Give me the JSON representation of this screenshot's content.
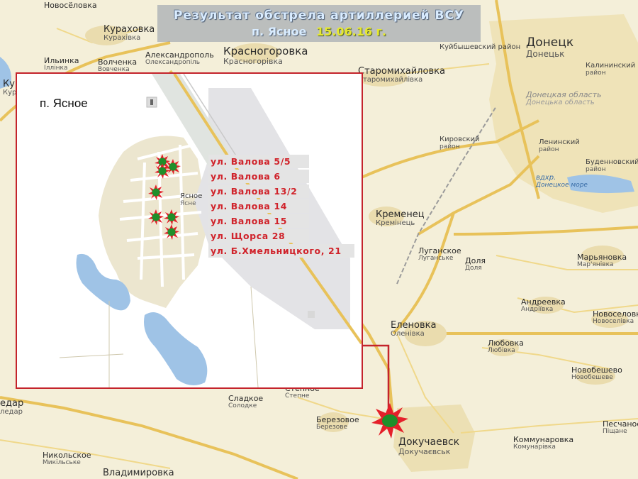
{
  "title": {
    "line1": "Результат обстрела артиллерией ВСУ",
    "place": "п. Ясное",
    "date": "15.06.16 г."
  },
  "colors": {
    "accent_red": "#d0232b",
    "explosion_red": "#e5202a",
    "explosion_green": "#1f8f2a",
    "date_yellow": "#e6e830",
    "banner_bg": "#8c96a5"
  },
  "inset": {
    "title": "п. Ясное",
    "village_label_ru": "Ясное",
    "village_label_ua": "Ясне",
    "addresses": [
      "ул. Валова 5/5",
      "ул. Валова 6",
      "ул. Валова 13/2",
      "ул. Валова 14",
      "ул. Валова 15",
      "ул. Щорса 28",
      "ул. Б.Хмельницкого, 21"
    ]
  },
  "icons": {
    "impact": "explosion-icon",
    "monument": "monument-icon"
  },
  "map_labels": {
    "novoselovka": {
      "ru": "Новосёловка"
    },
    "kurakhovka": {
      "ru": "Кураховка",
      "ua": "Курахівка"
    },
    "ilyinka": {
      "ru": "Ильинка",
      "ua": "Іллінка"
    },
    "kura": {
      "ru": "Кура",
      "ua": "Кур"
    },
    "volchenka": {
      "ru": "Волченка",
      "ua": "Вовченка"
    },
    "aleksandropol": {
      "ru": "Александрополь",
      "ua": "Олександропіль"
    },
    "krasnogorovka": {
      "ru": "Красногоровка",
      "ua": "Красногорівка"
    },
    "staromikhaylovka": {
      "ru": "Старомихайловка",
      "ua": "Старомихайлівка"
    },
    "donetsk": {
      "ru": "Донецк",
      "ua": "Донецьк"
    },
    "kuybyshevsky": {
      "ru": "Куйбышевский район"
    },
    "kalininsky": {
      "ru": "Калининский",
      "ua": "район"
    },
    "oblast": {
      "ru": "Донецкая область",
      "ua": "Донецька область"
    },
    "kirovsky": {
      "ru": "Кировский",
      "ua": "район"
    },
    "leninsky": {
      "ru": "Ленинский",
      "ua": "район"
    },
    "budennovsky": {
      "ru": "Буденновский",
      "ua": "район"
    },
    "reservoir": {
      "ru": "вдхр.",
      "ua": "Донецкое море"
    },
    "kremenets": {
      "ru": "Кременец",
      "ua": "Кремінець"
    },
    "luganskoe": {
      "ru": "Луганское",
      "ua": "Луганське"
    },
    "dolya": {
      "ru": "Доля",
      "ua": "Доля"
    },
    "maryanovka": {
      "ru": "Марьяновка",
      "ua": "Мар'янівка"
    },
    "andreevka": {
      "ru": "Андреевка",
      "ua": "Андріївка"
    },
    "novoselovka2": {
      "ru": "Новоселовка",
      "ua": "Новоселівка"
    },
    "yelenovka": {
      "ru": "Еленовка",
      "ua": "Оленівка"
    },
    "lyubovka": {
      "ru": "Любовка",
      "ua": "Любівка"
    },
    "novobeshevo": {
      "ru": "Новобешево",
      "ua": "Новобешеве"
    },
    "stepnoe": {
      "ru": "Степное",
      "ua": "Степне"
    },
    "sladkoe": {
      "ru": "Сладкое",
      "ua": "Солодке"
    },
    "berezovoe": {
      "ru": "Березовое",
      "ua": "Березове"
    },
    "dokuchaevsk": {
      "ru": "Докучаевск",
      "ua": "Докучаєвськ"
    },
    "peschanoe": {
      "ru": "Песчаное",
      "ua": "Піщане"
    },
    "kommunarovka": {
      "ru": "Коммунаровка",
      "ua": "Комунарівка"
    },
    "ugledar": {
      "ru": "едар",
      "ua": "ледар"
    },
    "nikolskoe": {
      "ru": "Никольское",
      "ua": "Микільське"
    },
    "vladimirovka": {
      "ru": "Владимировка"
    }
  }
}
